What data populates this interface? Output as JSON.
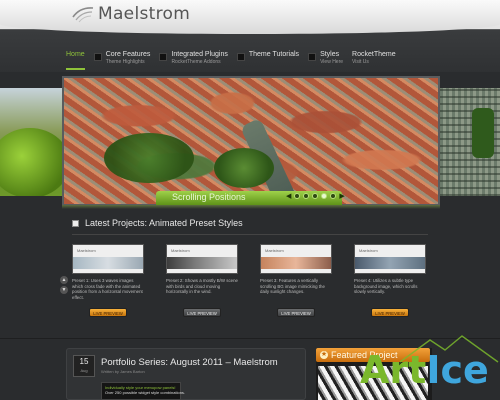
{
  "header": {
    "logo_text": "Maelstrom"
  },
  "nav": [
    {
      "label": "Home",
      "sub": "",
      "active": true
    },
    {
      "label": "Core Features",
      "sub": "Theme Highlights",
      "active": false
    },
    {
      "label": "Integrated Plugins",
      "sub": "RocketTheme Addons",
      "active": false
    },
    {
      "label": "Theme Tutorials",
      "sub": "",
      "active": false
    },
    {
      "label": "Styles",
      "sub": "View Here",
      "active": false
    },
    {
      "label": "RocketTheme",
      "sub": "Visit Us",
      "active": false
    }
  ],
  "showcase": {
    "caption": "Scrolling Positions",
    "dots_total": 5,
    "dot_active": 4,
    "prev_label": "◀",
    "next_label": "▶"
  },
  "projects": {
    "title": "Latest Projects: Animated Preset Styles",
    "items": [
      {
        "thumb_logo": "Maelstrom",
        "text": "Preset 1: Uses 3 waves images which cross fade with the animated position from a horizontal movement effect.",
        "button": "LIVE PREVIEW",
        "highlight": true
      },
      {
        "thumb_logo": "Maelstrom",
        "text": "Preset 2: Shows a mostly B/W scene with birds and cloud moving horizontally in the wind.",
        "button": "LIVE PREVIEW",
        "highlight": false
      },
      {
        "thumb_logo": "Maelstrom",
        "text": "Preset 3: Features a vertically scrolling BG image mimicking the daily sunlight changes.",
        "button": "LIVE PREVIEW",
        "highlight": false
      },
      {
        "thumb_logo": "Maelstrom",
        "text": "Preset 4: Utilizes a subtle type background image, which scrolls slowly vertically.",
        "button": "LIVE PREVIEW",
        "highlight": true
      }
    ]
  },
  "post": {
    "day": "15",
    "month": "Aug",
    "title": "Portfolio Series: August 2011 – Maelstrom",
    "meta": "Written by James Barton",
    "snippet_line1": "Individually style your menupow panels!",
    "snippet_line2": "Over 250 possible widget style combinations."
  },
  "featured": {
    "label": "Featured Project"
  },
  "watermark": {
    "part1": "Art",
    "part2": "Ice"
  },
  "colors": {
    "accent_green": "#8fc33a",
    "accent_orange": "#e48a1c",
    "background": "#2a2c2e"
  }
}
